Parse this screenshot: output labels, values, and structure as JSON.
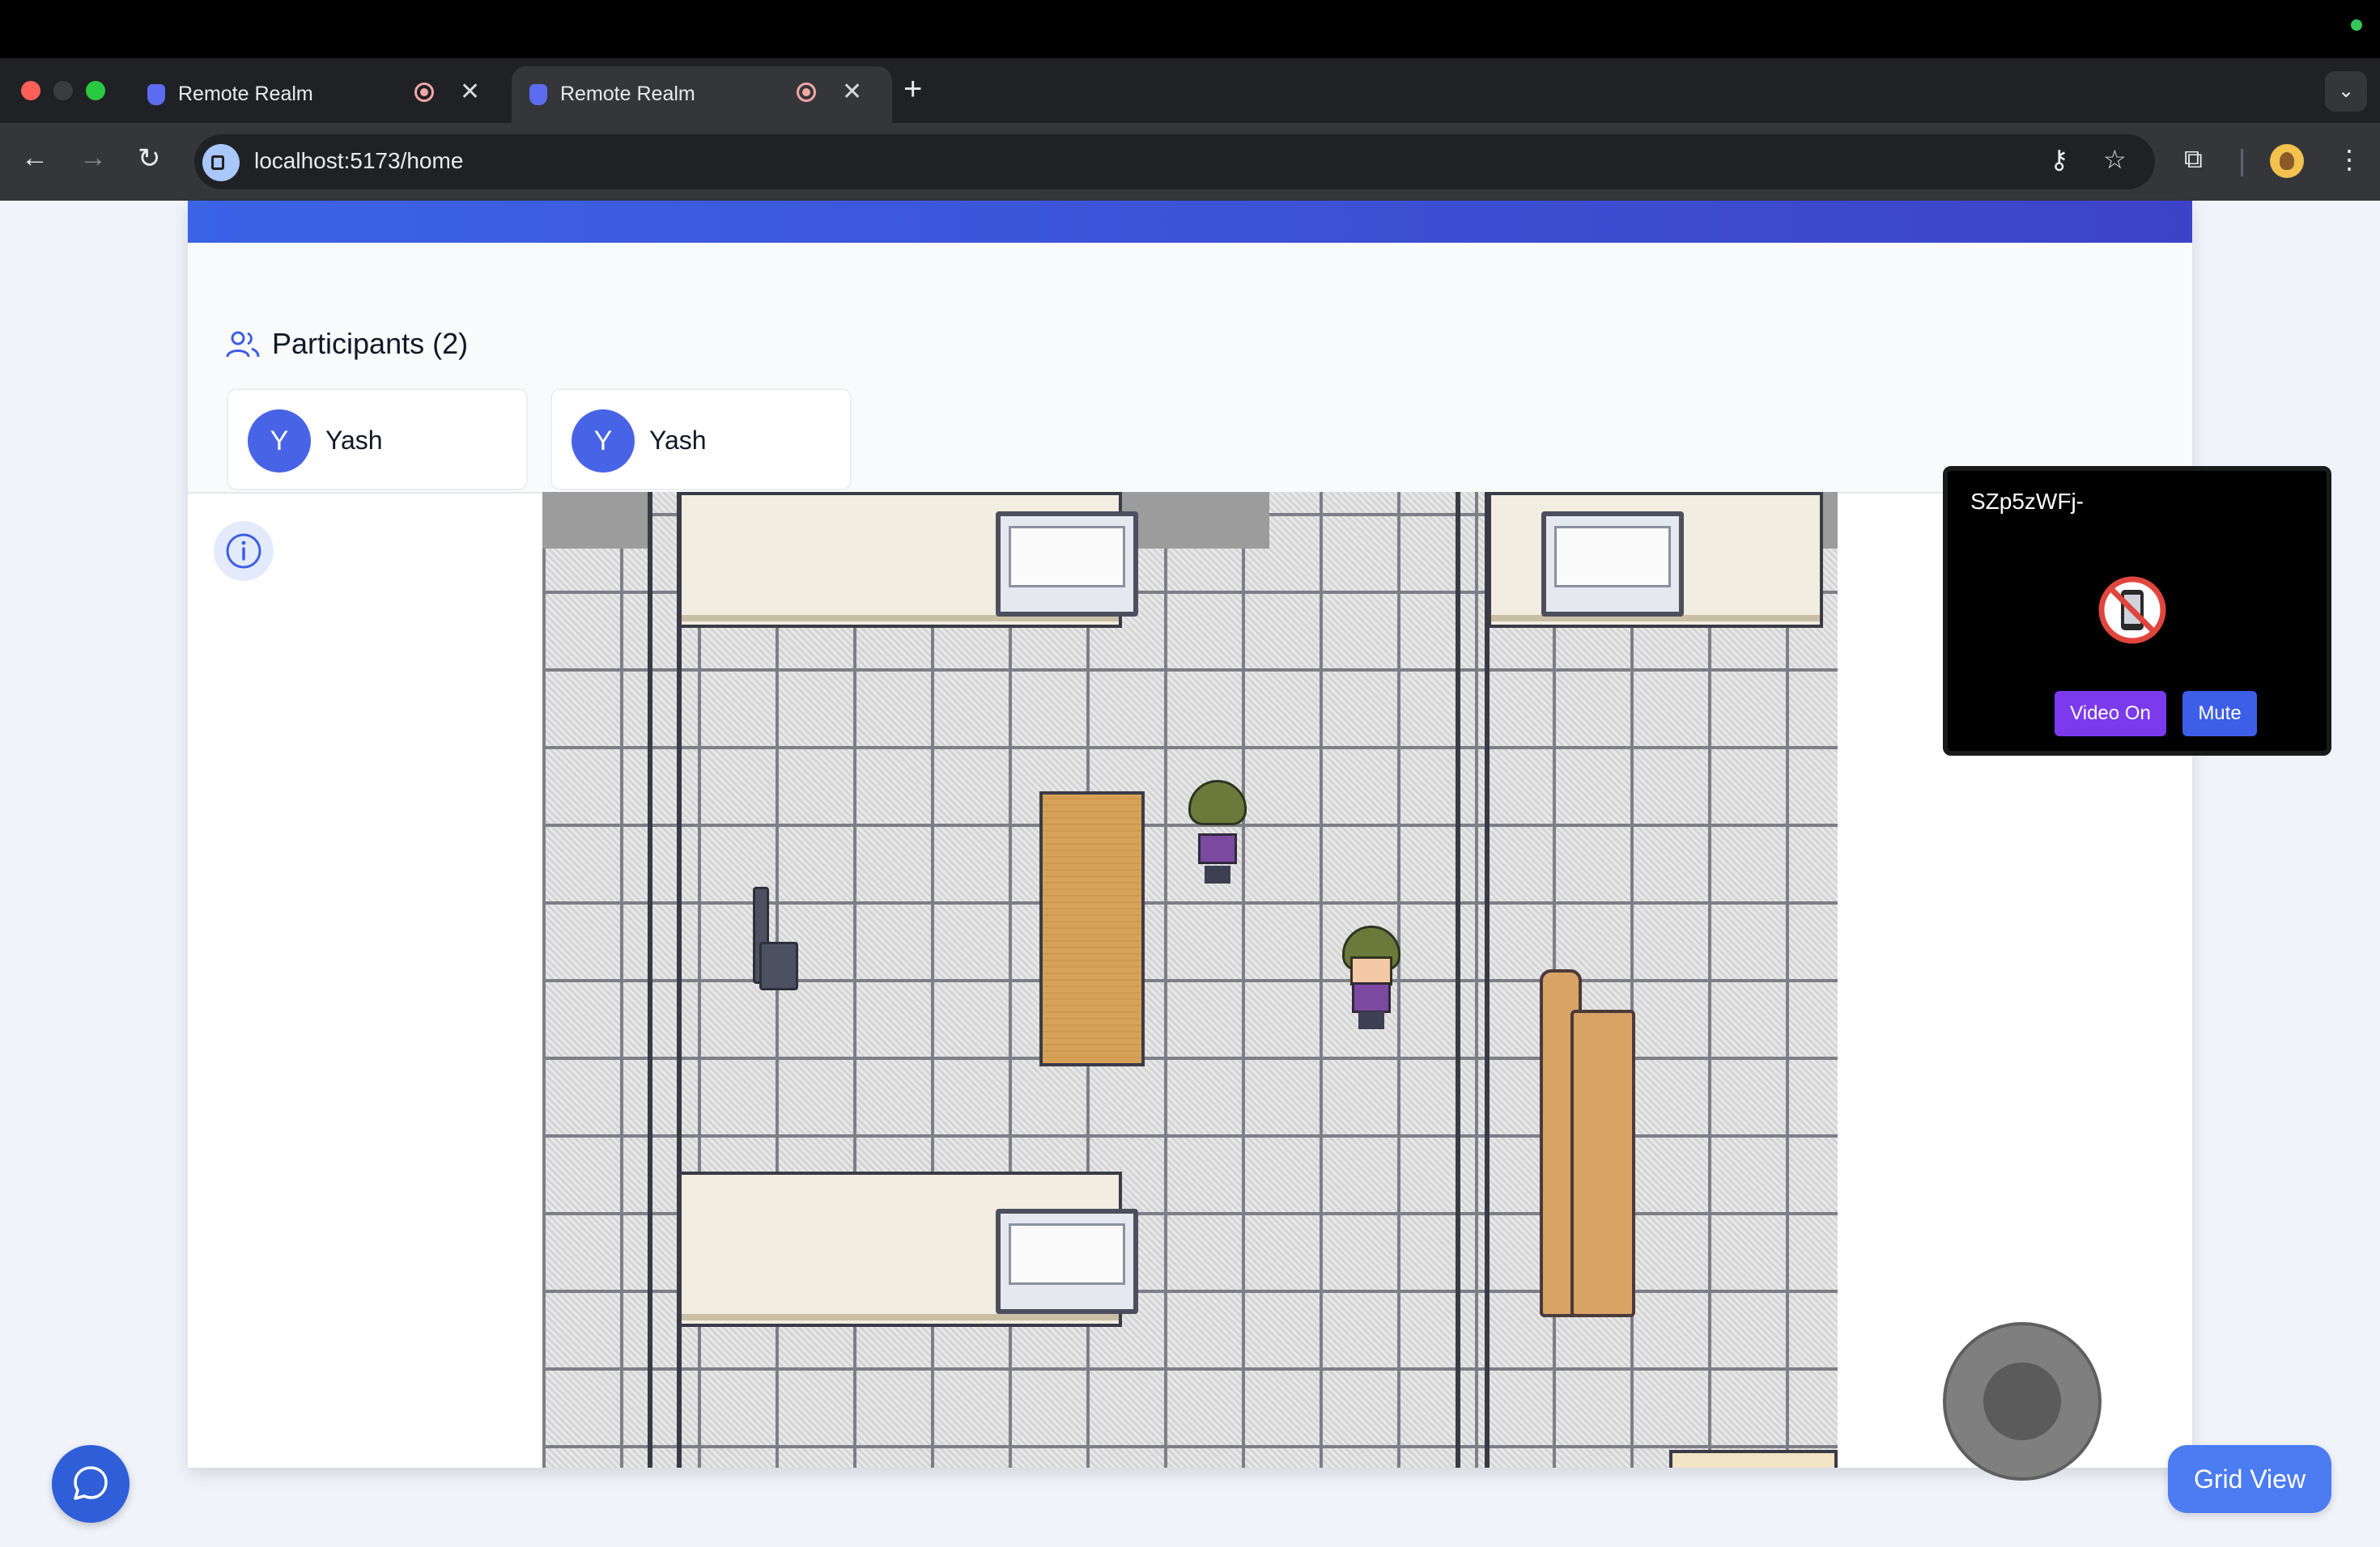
{
  "browser": {
    "tabs": [
      {
        "title": "Remote Realm",
        "active": false
      },
      {
        "title": "Remote Realm",
        "active": true
      }
    ],
    "url": "localhost:5173/home"
  },
  "icons": {
    "tab_close": "close-icon",
    "new_tab": "plus-icon",
    "tab_menu": "chevron-down-icon",
    "back": "arrow-left-icon",
    "forward": "arrow-right-icon",
    "reload": "reload-icon",
    "password": "key-icon",
    "bookmark": "star-icon",
    "extensions": "puzzle-icon",
    "menu": "kebab-icon",
    "participants": "users-icon",
    "info": "info-icon",
    "no_video": "no-mobile-icon",
    "chat": "chat-bubble-icon"
  },
  "glyphs": {
    "close": "✕",
    "plus": "+",
    "chevron": "⌄",
    "back": "←",
    "forward": "→",
    "reload": "↻",
    "key": "⚷",
    "star": "☆",
    "puzzle": "⧉",
    "kebab": "⋮"
  },
  "participants": {
    "title": "Participants (2)",
    "list": [
      {
        "initial": "Y",
        "name": "Yash"
      },
      {
        "initial": "Y",
        "name": "Yash"
      }
    ]
  },
  "video_panel": {
    "id_label": "SZp5zWFj-",
    "video_button": "Video On",
    "mute_button": "Mute"
  },
  "grid_view_button": "Grid View",
  "colors": {
    "accent": "#3d5ee6",
    "video_button": "#7c3aed",
    "grid_button": "#4b7cf1",
    "chat_button": "#2f5fd8"
  }
}
